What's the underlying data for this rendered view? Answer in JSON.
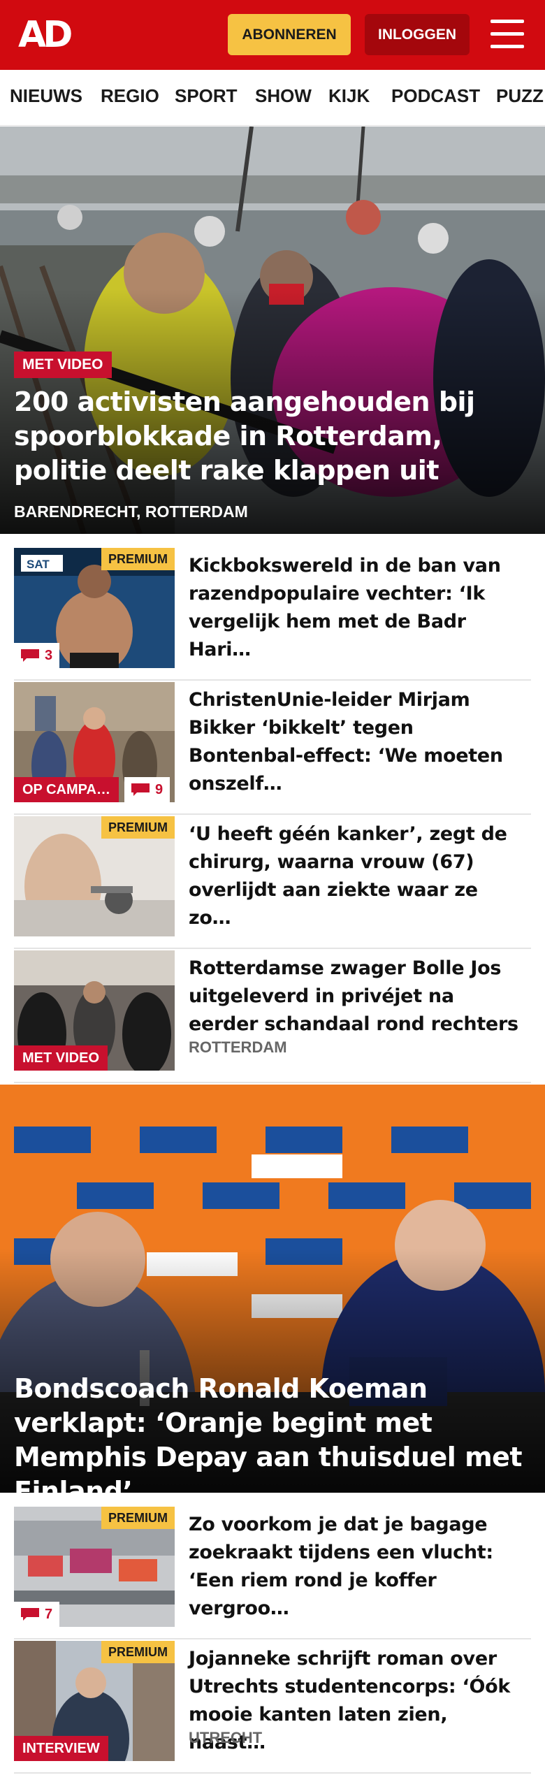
{
  "header": {
    "logo": "AD",
    "subscribe_label": "ABONNEREN",
    "login_label": "INLOGGEN",
    "menu_icon": "hamburger-menu-icon",
    "brand_color": "#d10a10",
    "subscribe_color": "#f6c243",
    "login_color": "#a4070c"
  },
  "nav": {
    "items": [
      "NIEUWS",
      "REGIO",
      "SPORT",
      "SHOW",
      "KIJK",
      "PODCAST",
      "PUZZ"
    ]
  },
  "hero1": {
    "badge": "MET VIDEO",
    "title": "200 activisten aangehouden bij spoorblokkade in Rotterdam, politie deelt rake klappen uit",
    "location": "BARENDRECHT, ROTTERDAM"
  },
  "articles1": [
    {
      "premium": "PREMIUM",
      "comments": "3",
      "title": "Kickbokswereld in de ban van razendpopulaire vechter: ‘Ik vergelijk hem met de Badr Hari…"
    },
    {
      "badge": "OP CAMPA…",
      "comments": "9",
      "title": "ChristenUnie-leider Mirjam Bikker ‘bikkelt’ tegen Bontenbal-effect: ‘We moeten onszelf…"
    },
    {
      "premium": "PREMIUM",
      "title": "‘U heeft géén kanker’, zegt de chirurg, waarna vrouw (67) overlijdt aan ziekte waar ze zo…"
    },
    {
      "badge": "MET VIDEO",
      "title": "Rotterdamse zwager Bolle Jos uitgeleverd in privéjet na eerder schandaal rond rechters",
      "location": "ROTTERDAM"
    }
  ],
  "hero2": {
    "title": "Bondscoach Ronald Koeman verklapt: ‘Oranje begint met Memphis Depay aan thuisduel met Finland’"
  },
  "articles2": [
    {
      "premium": "PREMIUM",
      "comments": "7",
      "title": "Zo voorkom je dat je bagage zoekraakt tijdens een vlucht: ‘Een riem rond je koffer vergroo…"
    },
    {
      "premium": "PREMIUM",
      "badge": "INTERVIEW",
      "title": "Jojanneke schrijft roman over Utrechts studentencorps: ‘Óók mooie kanten laten zien, naast…",
      "location": "UTRECHT"
    }
  ],
  "accent_red": "#c8102e"
}
